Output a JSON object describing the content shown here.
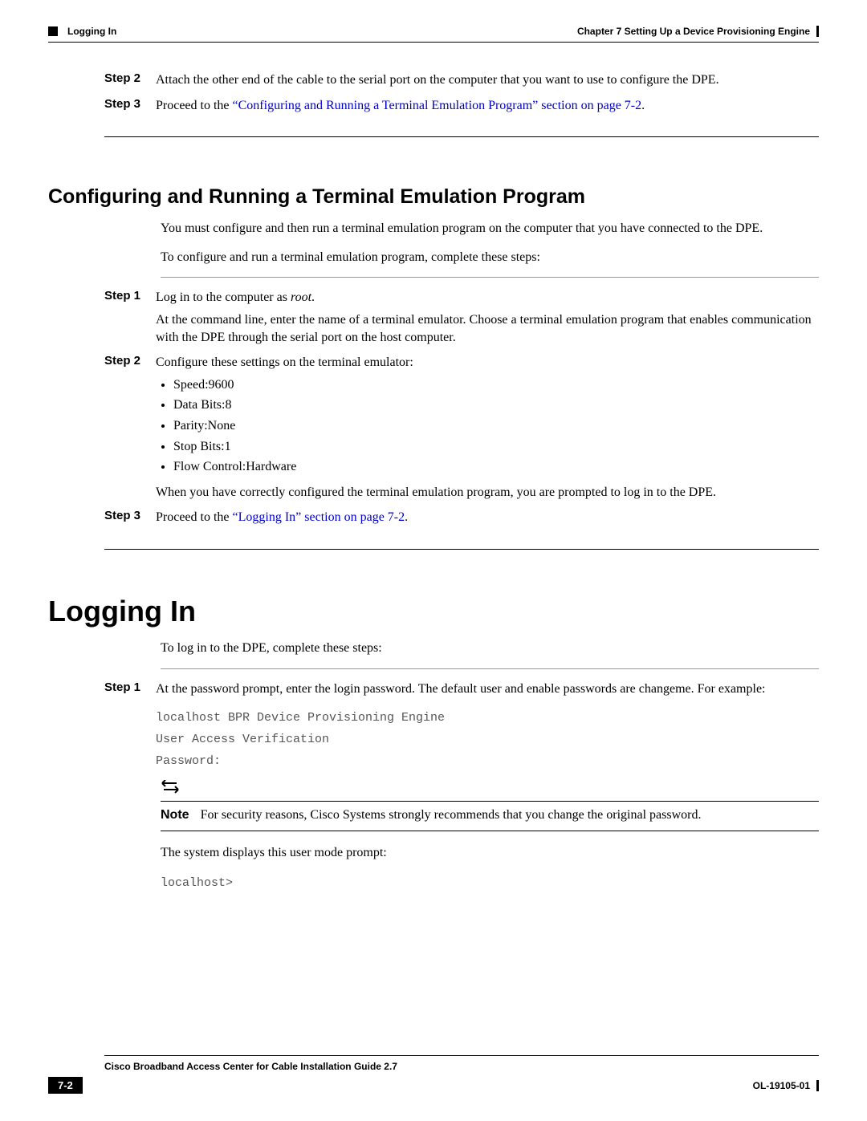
{
  "header": {
    "section": "Logging In",
    "chapter": "Chapter 7      Setting Up a Device Provisioning Engine"
  },
  "steps_top": {
    "s2_label": "Step 2",
    "s2_text": "Attach the other end of the cable to the serial port on the computer that you want to use to configure the DPE.",
    "s3_label": "Step 3",
    "s3_prefix": "Proceed to the ",
    "s3_link": "“Configuring and Running a Terminal Emulation Program” section on page 7-2",
    "s3_suffix": "."
  },
  "section1": {
    "title": "Configuring and Running a Terminal Emulation Program",
    "p1": "You must configure and then run a terminal emulation program on the computer that you have connected to the DPE.",
    "p2": "To configure and run a terminal emulation program, complete these steps:",
    "s1_label": "Step 1",
    "s1_text_a": "Log in to the computer as ",
    "s1_text_root": "root",
    "s1_text_b": ".",
    "s1_para2": "At the command line, enter the name of a terminal emulator. Choose a terminal emulation program that enables communication with the DPE through the serial port on the host computer.",
    "s2_label": "Step 2",
    "s2_text": "Configure these settings on the terminal emulator:",
    "bullets": {
      "b1": "Speed:9600",
      "b2": "Data Bits:8",
      "b3": "Parity:None",
      "b4": "Stop Bits:1",
      "b5": "Flow Control:Hardware"
    },
    "s2_after": "When you have correctly configured the terminal emulation program, you are prompted to log in to the DPE.",
    "s3_label": "Step 3",
    "s3_prefix": "Proceed to the ",
    "s3_link": "“Logging In” section on page 7-2",
    "s3_suffix": "."
  },
  "section2": {
    "title": "Logging In",
    "p1": "To log in to the DPE, complete these steps:",
    "s1_label": "Step 1",
    "s1_text": "At the password prompt, enter the login password. The default user and enable passwords are changeme. For example:",
    "code1": "localhost BPR Device Provisioning Engine",
    "code2": "User Access Verification",
    "code3": "Password:",
    "note_label": "Note",
    "note_text": "For security reasons, Cisco Systems strongly recommends that you change the original password.",
    "p2": "The system displays this user mode prompt:",
    "code4": "localhost>"
  },
  "footer": {
    "guide": "Cisco Broadband Access Center for Cable Installation Guide 2.7",
    "page": "7-2",
    "doc": "OL-19105-01"
  }
}
